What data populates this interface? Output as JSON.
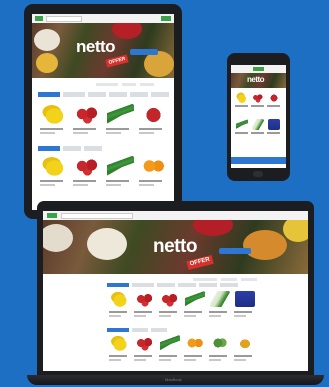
{
  "brand": {
    "logo_text": "netto",
    "stamp_text": "OFFER"
  },
  "laptop": {
    "footer_label": "MacBook"
  },
  "colors": {
    "background": "#1d6fc4",
    "accent": "#2d76d2",
    "brand_green": "#3aa34a",
    "stamp_red": "#d6322b"
  }
}
